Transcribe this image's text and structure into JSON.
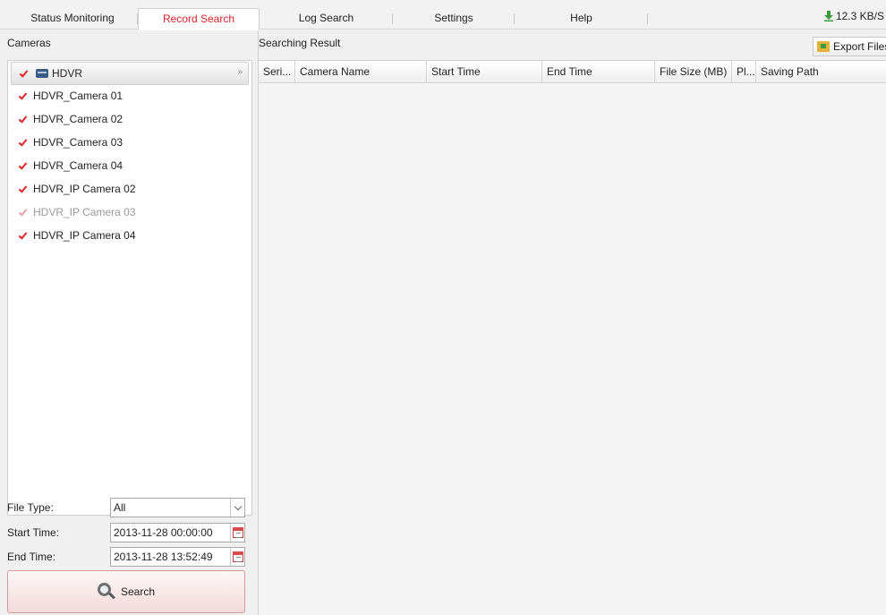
{
  "tabs": [
    {
      "label": "Status Monitoring",
      "active": false
    },
    {
      "label": "Record Search",
      "active": true
    },
    {
      "label": "Log Search",
      "active": false
    },
    {
      "label": "Settings",
      "active": false
    },
    {
      "label": "Help",
      "active": false
    }
  ],
  "speed": "12.3 KB/S",
  "left": {
    "title": "Cameras",
    "group": {
      "label": "HDVR",
      "checked": true
    },
    "cameras": [
      {
        "label": "HDVR_Camera 01",
        "checked": true,
        "enabled": true
      },
      {
        "label": "HDVR_Camera 02",
        "checked": true,
        "enabled": true
      },
      {
        "label": "HDVR_Camera 03",
        "checked": true,
        "enabled": true
      },
      {
        "label": "HDVR_Camera 04",
        "checked": true,
        "enabled": true
      },
      {
        "label": "HDVR_IP Camera 02",
        "checked": true,
        "enabled": true
      },
      {
        "label": "HDVR_IP Camera 03",
        "checked": true,
        "enabled": false
      },
      {
        "label": "HDVR_IP Camera 04",
        "checked": true,
        "enabled": true
      }
    ],
    "file_type": {
      "label": "File Type:",
      "value": "All"
    },
    "start_time": {
      "label": "Start Time:",
      "value": "2013-11-28 00:00:00"
    },
    "end_time": {
      "label": "End Time:",
      "value": "2013-11-28 13:52:49"
    },
    "search_label": "Search"
  },
  "right": {
    "title": "Searching Result",
    "export_label": "Export Files",
    "columns": [
      "Seri...",
      "Camera Name",
      "Start Time",
      "End Time",
      "File Size (MB)",
      "Pl...",
      "Saving Path"
    ],
    "rows": []
  },
  "colors": {
    "accent": "#e0212a",
    "background": "#f0f0f0"
  }
}
